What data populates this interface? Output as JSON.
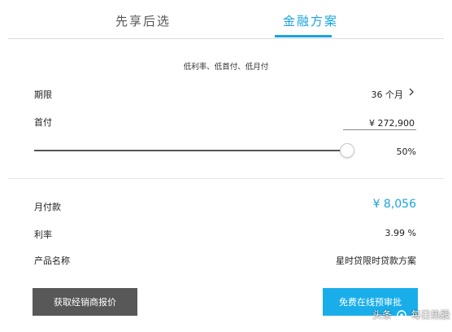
{
  "tabs": [
    {
      "label": "先享后选",
      "active": false
    },
    {
      "label": "金融方案",
      "active": true
    }
  ],
  "accent_color": "#1aa3e0",
  "subtitle": "低利率、低首付、低月付",
  "term": {
    "label": "期限",
    "value": "36 个月"
  },
  "down_payment": {
    "label": "首付",
    "value": "¥ 272,900"
  },
  "slider": {
    "percent": 50,
    "label": "50%"
  },
  "monthly_payment": {
    "label": "月付款",
    "value": "¥ 8,056"
  },
  "interest_rate": {
    "label": "利率",
    "value": "3.99 %"
  },
  "product_name": {
    "label": "产品名称",
    "value": "星时贷限时贷款方案"
  },
  "buttons": {
    "dealer_quote": "获取经销商报价",
    "prequalify": "免费在线预审批"
  },
  "watermark": {
    "prefix": "头条",
    "suffix": "每日热股"
  }
}
